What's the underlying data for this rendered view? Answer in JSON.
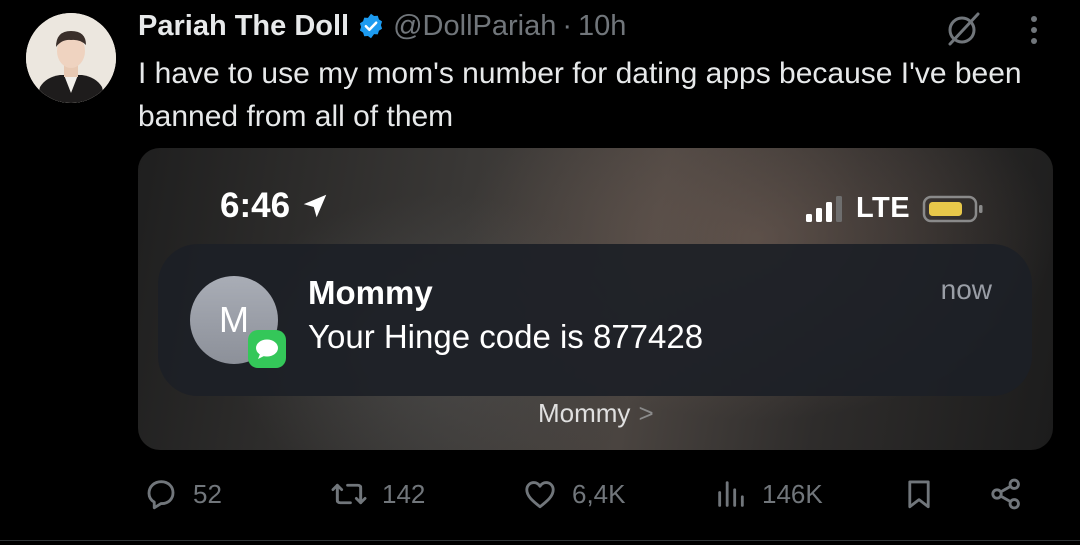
{
  "tweet": {
    "display_name": "Pariah The Doll",
    "handle": "@DollPariah",
    "separator": "·",
    "time": "10h",
    "text": "I have to use my mom's number for dating apps because I've been banned from all of them",
    "icons": {
      "verified": "verified-badge-icon",
      "grok": "grok-icon",
      "more": "more-vertical-icon"
    }
  },
  "media": {
    "status_bar": {
      "time": "6:46",
      "network": "LTE",
      "location_icon": "location-arrow-icon",
      "signal_icon": "cellular-signal-icon",
      "battery_icon": "battery-icon"
    },
    "notification": {
      "avatar_initial": "M",
      "sender": "Mommy",
      "body": "Your Hinge code is 877428",
      "time": "now",
      "app_icon": "messages-app-icon"
    },
    "group_label": "Mommy",
    "group_chevron": ">"
  },
  "actions": {
    "replies": "52",
    "reposts": "142",
    "likes": "6,4K",
    "views": "146K"
  },
  "colors": {
    "background": "#000000",
    "text_primary": "#e7e9ea",
    "text_secondary": "#71767b",
    "verified_blue": "#1d9bf0",
    "battery_yellow": "#e8c84a",
    "messages_green": "#34c759"
  }
}
